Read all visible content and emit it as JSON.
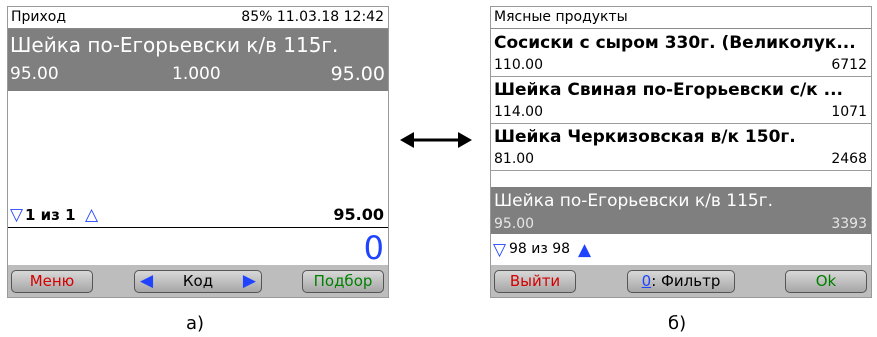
{
  "screen_a": {
    "title": "Приход",
    "status": "85% 11.03.18 12:42",
    "item": {
      "name": "Шейка по-Егорьевски к/в 115г.",
      "price": "95.00",
      "qty": "1.000",
      "sum": "95.00"
    },
    "nav": {
      "down_arrow": "▽",
      "text": "1 из 1",
      "up_arrow": "△"
    },
    "total": "95.00",
    "big_total": "0",
    "buttons": {
      "menu": "Меню",
      "code": "Код",
      "pick": "Подбор"
    },
    "colors": {
      "menu": "#d40000",
      "pick": "#008000",
      "code_arrows": "#1f43ff"
    }
  },
  "swap_arrow": "⟷",
  "screen_b": {
    "title": "Мясные продукты",
    "items": [
      {
        "name": "Сосиски с сыром 330г. (Великолук...",
        "price": "110.00",
        "qty": "6712"
      },
      {
        "name": "Шейка Свиная по-Егорьевски с/к ...",
        "price": "114.00",
        "qty": "1071"
      },
      {
        "name": "Шейка Черкизовская в/к 150г.",
        "price": "81.00",
        "qty": "2468"
      },
      {
        "name": "Шейка по-Егорьевски к/в 115г.",
        "price": "95.00",
        "qty": "3393"
      }
    ],
    "nav": {
      "down_arrow": "▽",
      "text": "98 из 98",
      "up_arrow": "▲"
    },
    "buttons": {
      "exit": "Выйти",
      "filter_key": "0",
      "filter_label": ": Фильтр",
      "ok": "Ok"
    },
    "colors": {
      "exit": "#d40000",
      "ok": "#008000",
      "filter_key": "#1f43ff"
    }
  },
  "captions": {
    "a": "а)",
    "b": "б)"
  }
}
